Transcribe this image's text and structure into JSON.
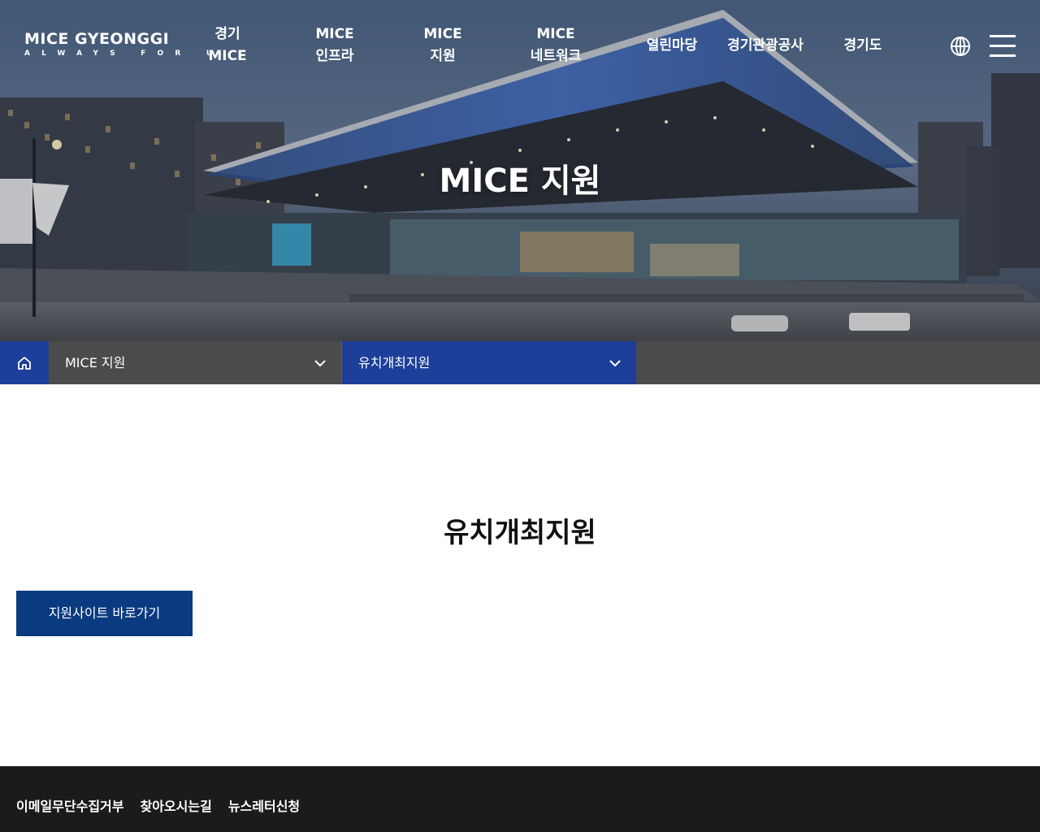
{
  "header": {
    "logo_main": "MICE GYEONGGI",
    "logo_sub": "ALWAYS FOR U",
    "nav": [
      {
        "line1": "경기",
        "line2": "MICE"
      },
      {
        "line1": "MICE",
        "line2": "인프라"
      },
      {
        "line1": "MICE",
        "line2": "지원"
      },
      {
        "line1": "MICE",
        "line2": "네트워크"
      },
      {
        "line1": "열린마당",
        "line2": ""
      },
      {
        "line1": "경기관광공사",
        "line2": ""
      },
      {
        "line1": "경기도",
        "line2": ""
      }
    ],
    "icons": {
      "language": "globe-icon",
      "menu": "hamburger-icon"
    }
  },
  "hero": {
    "title": "MICE 지원"
  },
  "location": {
    "home_icon": "home-icon",
    "depth1": "MICE 지원",
    "depth2": "유치개최지원"
  },
  "colors": {
    "accent_blue": "#1d3f9a",
    "button_navy": "#0a3a80",
    "location_gray": "#4b4b4b",
    "footer_bg": "#1b1b1b"
  },
  "main": {
    "title": "유치개최지원",
    "site_button": "지원사이트 바로가기"
  },
  "footer": {
    "links": [
      "이메일무단수집거부",
      "찾아오시는길",
      "뉴스레터신청"
    ]
  }
}
